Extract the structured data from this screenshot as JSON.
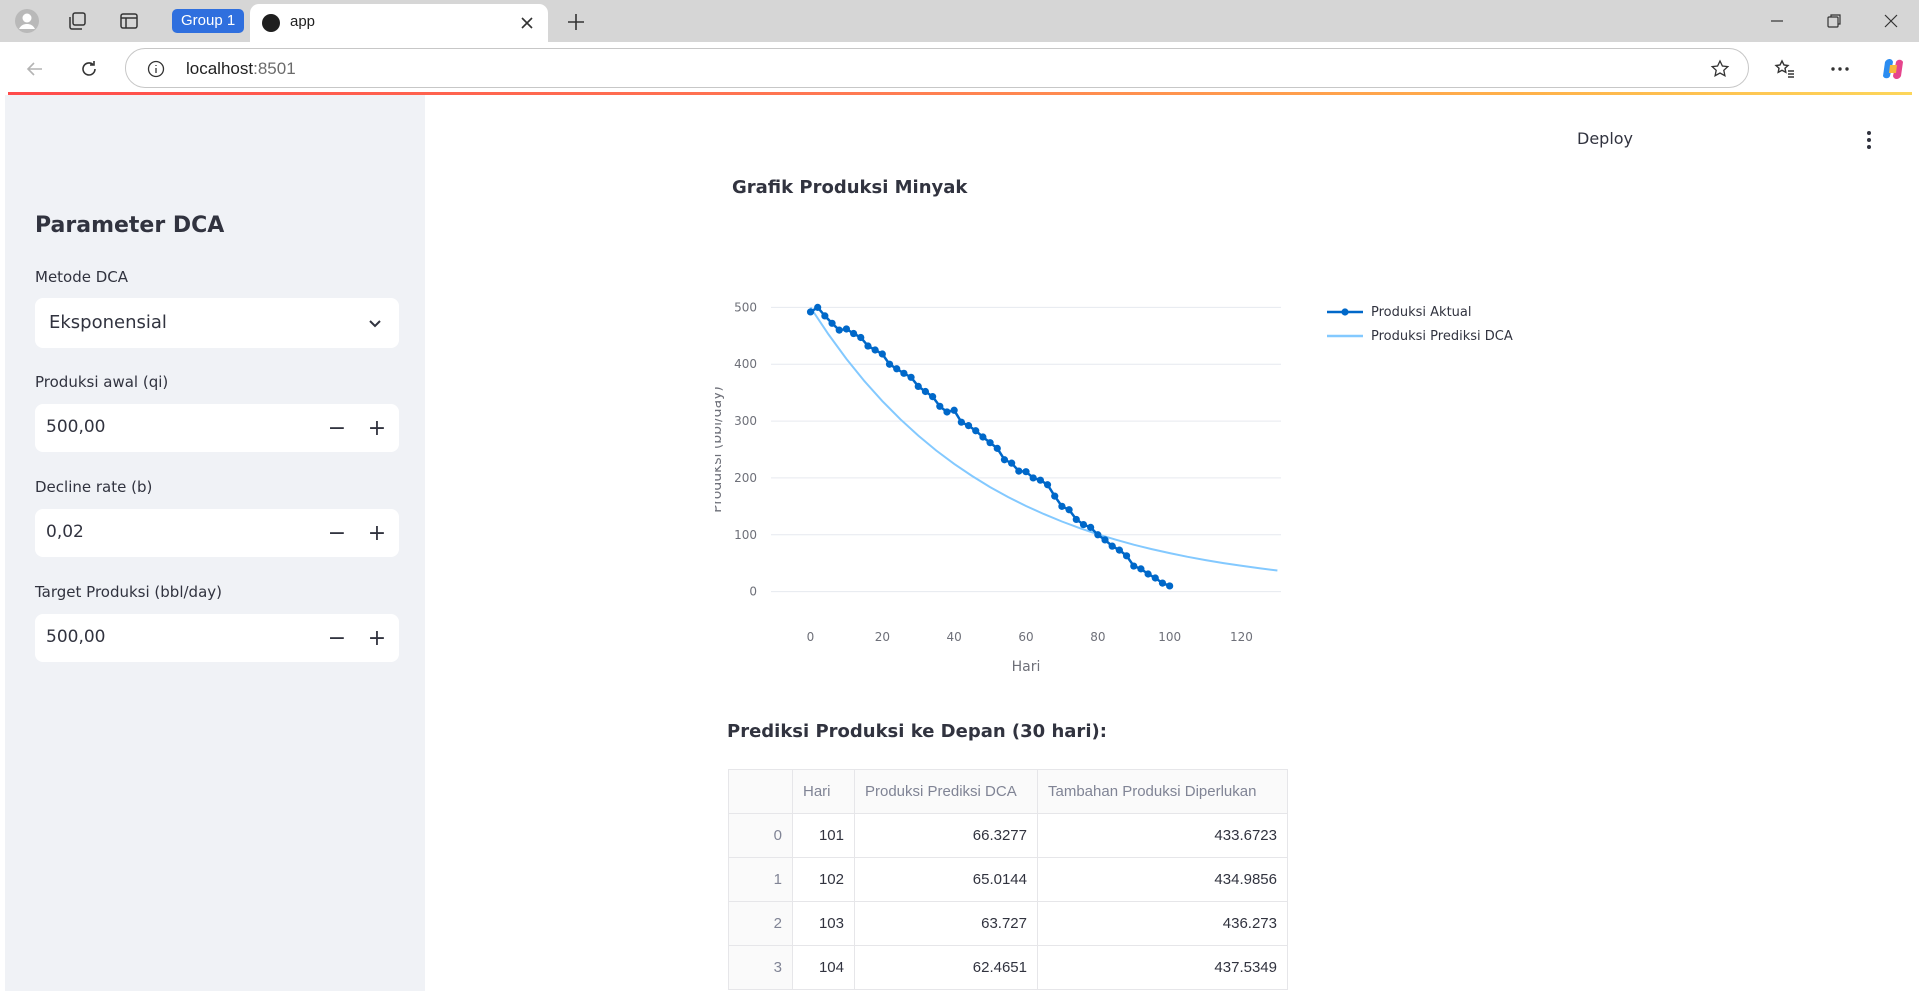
{
  "browser": {
    "tab_group_label": "Group 1",
    "tab_title": "app",
    "url_host": "localhost",
    "url_port": ":8501"
  },
  "header": {
    "deploy_label": "Deploy"
  },
  "sidebar": {
    "title": "Parameter DCA",
    "method": {
      "label": "Metode DCA",
      "value": "Eksponensial"
    },
    "qi": {
      "label": "Produksi awal (qi)",
      "value": "500,00"
    },
    "decline": {
      "label": "Decline rate (b)",
      "value": "0,02"
    },
    "target": {
      "label": "Target Produksi (bbl/day)",
      "value": "500,00"
    }
  },
  "chart_section": {
    "title": "Grafik Produksi Minyak"
  },
  "chart_data": {
    "type": "line",
    "xlabel": "Hari",
    "ylabel": "Produksi (bbl/day)",
    "xlim": [
      -11,
      131
    ],
    "ylim": [
      -20,
      520
    ],
    "xticks": [
      0,
      20,
      40,
      60,
      80,
      100,
      120
    ],
    "yticks": [
      0,
      100,
      200,
      300,
      400,
      500
    ],
    "grid": "horizontal",
    "legend_position": "top-right",
    "series": [
      {
        "name": "Produksi Aktual",
        "color": "#0068c9",
        "mode": "lines+markers",
        "x": [
          0,
          2,
          4,
          6,
          8,
          10,
          12,
          14,
          16,
          18,
          20,
          22,
          24,
          26,
          28,
          30,
          32,
          34,
          36,
          38,
          40,
          42,
          44,
          46,
          48,
          50,
          52,
          54,
          56,
          58,
          60,
          62,
          64,
          66,
          68,
          70,
          72,
          74,
          76,
          78,
          80,
          82,
          84,
          86,
          88,
          90,
          92,
          94,
          96,
          98,
          100
        ],
        "y": [
          492,
          500,
          485,
          472,
          460,
          462,
          454,
          447,
          432,
          425,
          418,
          400,
          392,
          384,
          377,
          361,
          352,
          343,
          326,
          316,
          319,
          298,
          292,
          283,
          272,
          262,
          252,
          232,
          226,
          212,
          211,
          200,
          196,
          188,
          168,
          150,
          144,
          127,
          118,
          113,
          100,
          91,
          80,
          73,
          63,
          45,
          40,
          31,
          24,
          15,
          10
        ]
      },
      {
        "name": "Produksi Prediksi DCA",
        "color": "#83c9ff",
        "mode": "lines",
        "equation": "500*exp(-0.02*x)",
        "x": [
          0,
          5,
          10,
          15,
          20,
          25,
          30,
          35,
          40,
          45,
          50,
          55,
          60,
          65,
          70,
          75,
          80,
          85,
          90,
          95,
          100,
          105,
          110,
          115,
          120,
          125,
          130
        ],
        "y": [
          500,
          452.4,
          409.4,
          370.4,
          335.2,
          303.3,
          274.4,
          248.3,
          224.7,
          203.3,
          183.9,
          166.4,
          150.6,
          136.3,
          123.3,
          111.6,
          100.9,
          91.3,
          82.6,
          74.8,
          67.7,
          61.2,
          55.4,
          50.1,
          45.4,
          41.0,
          37.1
        ]
      }
    ]
  },
  "table_section": {
    "title": "Prediksi Produksi ke Depan (30 hari):",
    "columns": [
      "",
      "Hari",
      "Produksi Prediksi DCA",
      "Tambahan Produksi Diperlukan"
    ],
    "rows": [
      [
        "0",
        "101",
        "66.3277",
        "433.6723"
      ],
      [
        "1",
        "102",
        "65.0144",
        "434.9856"
      ],
      [
        "2",
        "103",
        "63.727",
        "436.273"
      ],
      [
        "3",
        "104",
        "62.4651",
        "437.5349"
      ]
    ]
  }
}
